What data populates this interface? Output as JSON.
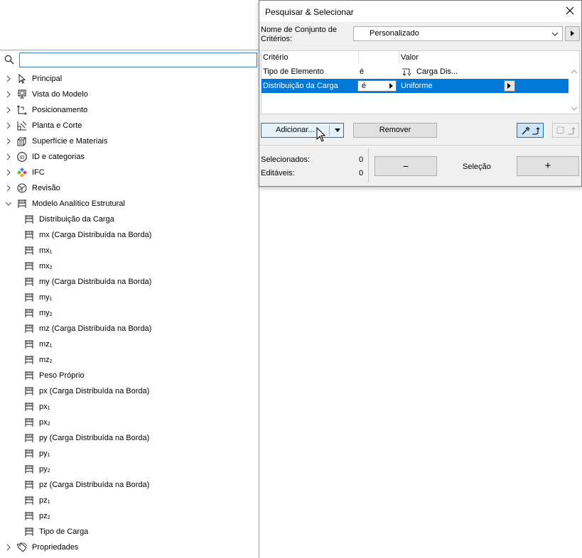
{
  "tree": {
    "search": {
      "value": "",
      "placeholder": ""
    },
    "items": [
      {
        "label": "Principal",
        "icon": "arrow-pointer-icon",
        "level": 0,
        "expanded": false
      },
      {
        "label": "Vista do Modelo",
        "icon": "monitor-icon",
        "level": 0,
        "expanded": false
      },
      {
        "label": "Posicionamento",
        "icon": "positioning-icon",
        "level": 0,
        "expanded": false
      },
      {
        "label": "Planta e Corte",
        "icon": "floorplan-section-icon",
        "level": 0,
        "expanded": false
      },
      {
        "label": "Superfície e Materiais",
        "icon": "materials-icon",
        "level": 0,
        "expanded": false
      },
      {
        "label": "ID e categorias",
        "icon": "id-icon",
        "level": 0,
        "expanded": false
      },
      {
        "label": "IFC",
        "icon": "ifc-icon",
        "level": 0,
        "expanded": false
      },
      {
        "label": "Revisão",
        "icon": "revision-icon",
        "level": 0,
        "expanded": false
      },
      {
        "label": "Modelo Analítico Estrutural",
        "icon": "structural-load-icon",
        "level": 0,
        "expanded": true
      },
      {
        "label": "Distribuição da Carga",
        "icon": "structural-load-icon",
        "level": 1
      },
      {
        "label": "mx (Carga Distribuída na Borda)",
        "icon": "structural-load-icon",
        "level": 1
      },
      {
        "label": "mx",
        "sub": "1",
        "icon": "structural-load-icon",
        "level": 1
      },
      {
        "label": "mx",
        "sub": "2",
        "icon": "structural-load-icon",
        "level": 1
      },
      {
        "label": "my (Carga Distribuída na Borda)",
        "icon": "structural-load-icon",
        "level": 1
      },
      {
        "label": "my",
        "sub": "1",
        "icon": "structural-load-icon",
        "level": 1
      },
      {
        "label": "my",
        "sub": "2",
        "icon": "structural-load-icon",
        "level": 1
      },
      {
        "label": "mz (Carga Distribuída na Borda)",
        "icon": "structural-load-icon",
        "level": 1
      },
      {
        "label": "mz",
        "sub": "1",
        "icon": "structural-load-icon",
        "level": 1
      },
      {
        "label": "mz",
        "sub": "2",
        "icon": "structural-load-icon",
        "level": 1
      },
      {
        "label": "Peso Próprio",
        "icon": "structural-load-icon",
        "level": 1
      },
      {
        "label": "px (Carga Distribuída na Borda)",
        "icon": "structural-load-icon",
        "level": 1
      },
      {
        "label": "px",
        "sub": "1",
        "icon": "structural-load-icon",
        "level": 1
      },
      {
        "label": "px",
        "sub": "2",
        "icon": "structural-load-icon",
        "level": 1
      },
      {
        "label": "py (Carga Distribuída na Borda)",
        "icon": "structural-load-icon",
        "level": 1
      },
      {
        "label": "py",
        "sub": "1",
        "icon": "structural-load-icon",
        "level": 1
      },
      {
        "label": "py",
        "sub": "2",
        "icon": "structural-load-icon",
        "level": 1
      },
      {
        "label": "pz (Carga Distribuída na Borda)",
        "icon": "structural-load-icon",
        "level": 1
      },
      {
        "label": "pz",
        "sub": "1",
        "icon": "structural-load-icon",
        "level": 1
      },
      {
        "label": "pz",
        "sub": "2",
        "icon": "structural-load-icon",
        "level": 1
      },
      {
        "label": "Tipo de Carga",
        "icon": "structural-load-icon",
        "level": 1
      },
      {
        "label": "Propriedades",
        "icon": "tag-icon",
        "level": 0,
        "expanded": false
      }
    ]
  },
  "dialog": {
    "title": "Pesquisar & Selecionar",
    "criteria_set_label": "Nome de Conjunto de Critérios:",
    "criteria_set_value": "Personalizado",
    "table": {
      "headers": [
        "Critério",
        "",
        "Valor"
      ],
      "rows": [
        {
          "criterion": "Tipo de Elemento",
          "operator": "é",
          "value": "Carga Dis...",
          "selected": false
        },
        {
          "criterion": "Distribuição da Carga",
          "operator": "é",
          "value": "Uniforme",
          "selected": true
        }
      ]
    },
    "add_label": "Adicionar...",
    "remove_label": "Remover",
    "selected_label": "Selecionados:",
    "selected_count": "0",
    "editable_label": "Editáveis:",
    "editable_count": "0",
    "minus_label": "−",
    "selection_label": "Seleção",
    "plus_label": "+"
  },
  "colors": {
    "selection": "#0078d7",
    "accent_blue": "#0078d7",
    "dialog_bg": "#f0f0f0"
  }
}
